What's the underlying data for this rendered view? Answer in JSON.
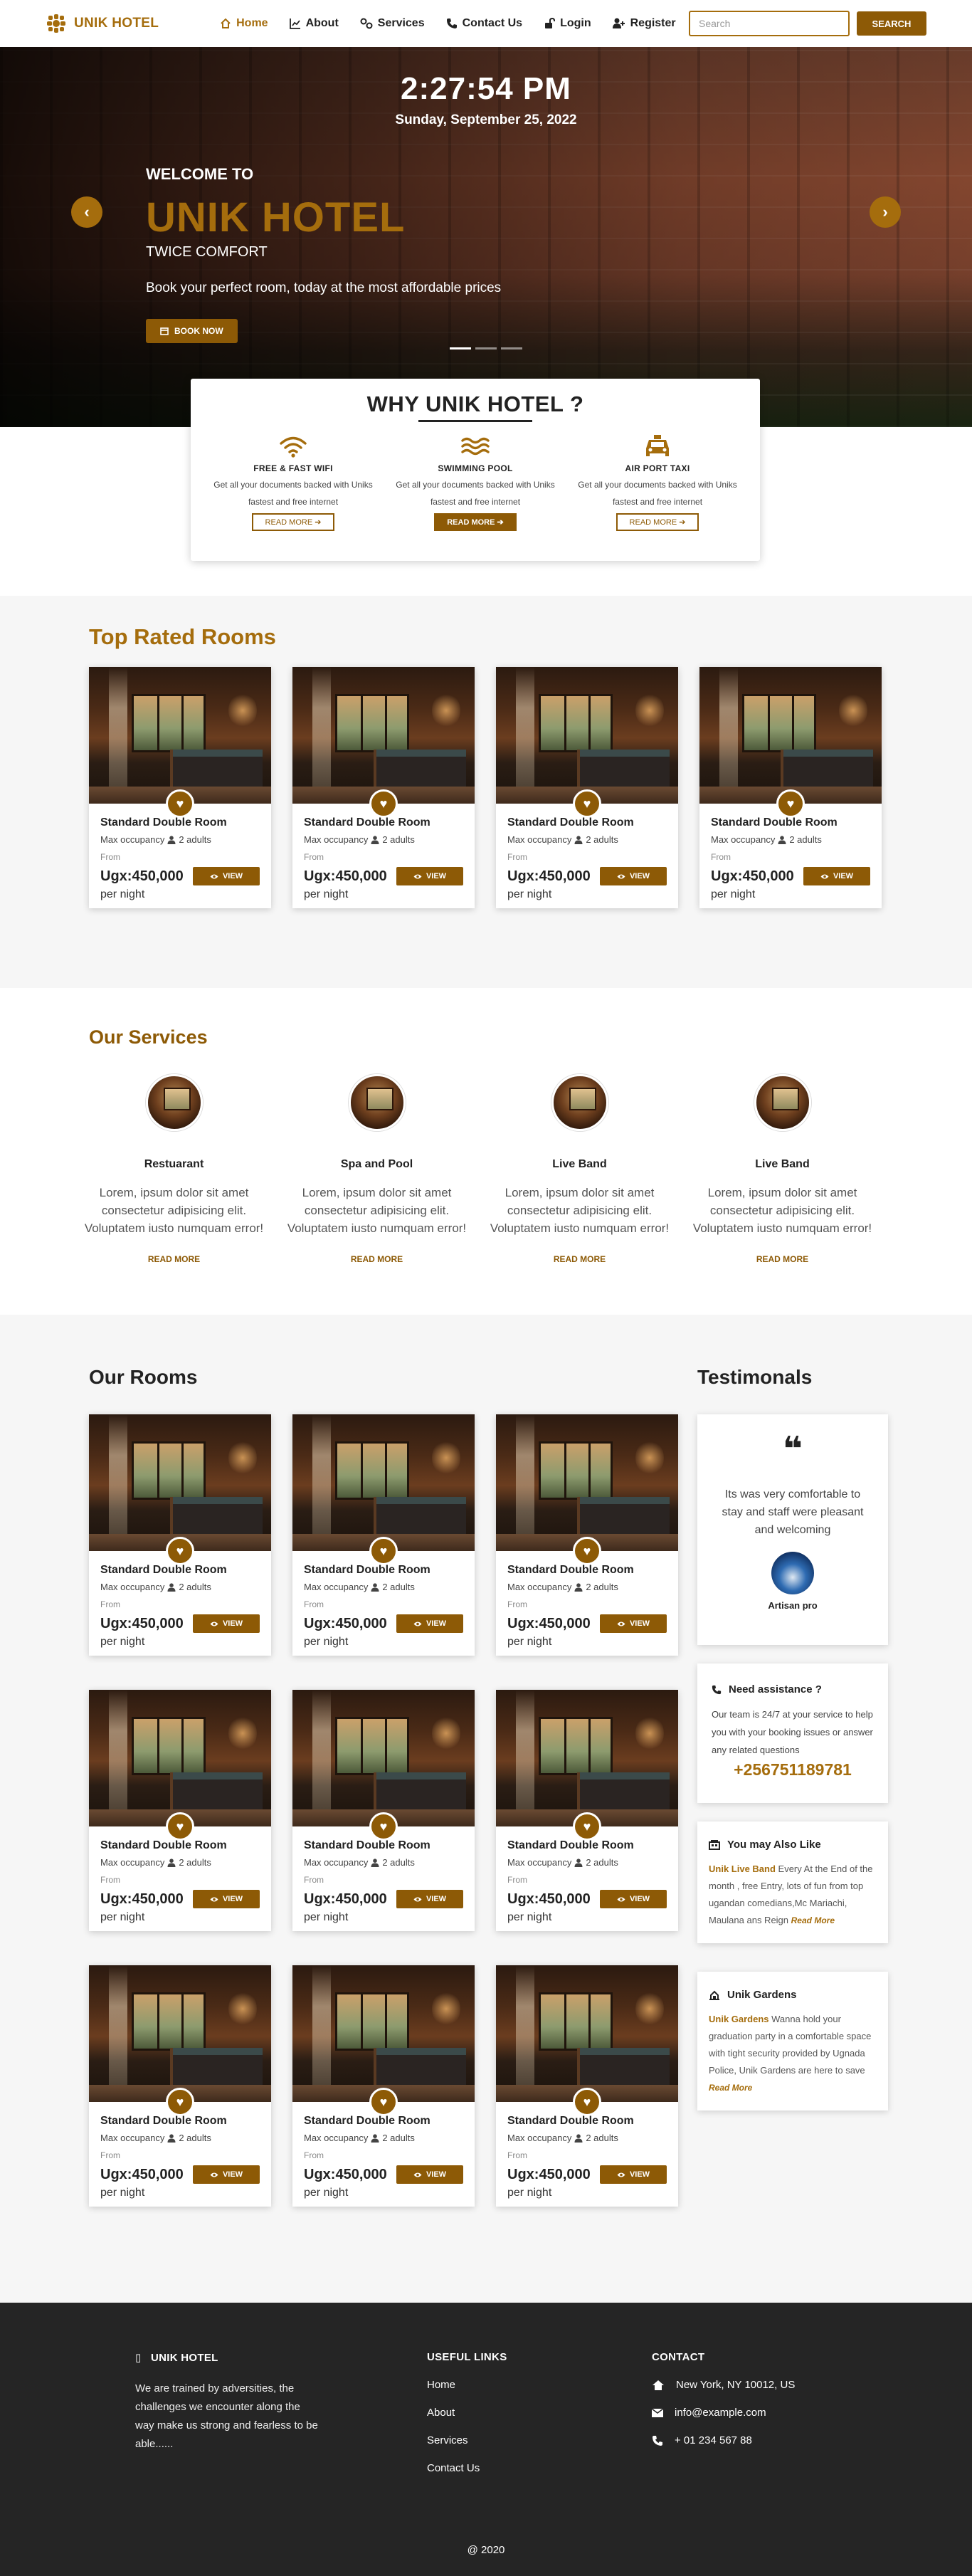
{
  "nav": {
    "brand": "UNIK HOTEL",
    "items": [
      {
        "label": "Home",
        "icon": "home-icon",
        "active": true
      },
      {
        "label": "About",
        "icon": "chart-icon"
      },
      {
        "label": "Services",
        "icon": "services-icon"
      },
      {
        "label": "Contact Us",
        "icon": "phone-icon"
      },
      {
        "label": "Login",
        "icon": "login-icon"
      },
      {
        "label": "Register",
        "icon": "register-icon"
      }
    ],
    "search_placeholder": "Search",
    "search_button": "SEARCH"
  },
  "hero": {
    "time": "2:27:54 PM",
    "date": "Sunday, September 25, 2022",
    "welcome": "WELCOME TO",
    "title": "UNIK HOTEL",
    "tagline": "TWICE COMFORT",
    "subline": "Book your perfect room, today at the most affordable prices",
    "book_button": "BOOK NOW",
    "prev": "‹",
    "next": "›"
  },
  "why": {
    "title": "WHY UNIK HOTEL ?",
    "features": [
      {
        "title": "FREE & FAST WIFI",
        "icon": "wifi-icon",
        "desc": "Get all your documents backed with Uniks fastest and free internet",
        "button": "READ MORE"
      },
      {
        "title": "SWIMMING POOL",
        "icon": "pool-icon",
        "desc": "Get all your documents backed with Uniks fastest and free internet",
        "button": "READ MORE"
      },
      {
        "title": "AIR PORT TAXI",
        "icon": "taxi-icon",
        "desc": "Get all your documents backed with Uniks fastest and free internet",
        "button": "READ MORE"
      }
    ]
  },
  "room_card": {
    "name": "Standard Double Room",
    "occupancy": "Max occupancy",
    "adults": "2 adults",
    "from": "From",
    "price": "Ugx:450,000",
    "view": "VIEW",
    "per_night": "per night"
  },
  "top_rated": {
    "title": "Top Rated Rooms"
  },
  "services": {
    "title": "Our Services",
    "items": [
      {
        "name": "Restuarant",
        "desc": "Lorem, ipsum dolor sit amet consectetur adipisicing elit. Voluptatem iusto numquam error!",
        "link": "READ MORE"
      },
      {
        "name": "Spa and Pool",
        "desc": "Lorem, ipsum dolor sit amet consectetur adipisicing elit. Voluptatem iusto numquam error!",
        "link": "READ MORE"
      },
      {
        "name": "Live Band",
        "desc": "Lorem, ipsum dolor sit amet consectetur adipisicing elit. Voluptatem iusto numquam error!",
        "link": "READ MORE"
      },
      {
        "name": "Live Band",
        "desc": "Lorem, ipsum dolor sit amet consectetur adipisicing elit. Voluptatem iusto numquam error!",
        "link": "READ MORE"
      }
    ]
  },
  "our_rooms": {
    "title": "Our Rooms"
  },
  "testimonials": {
    "title": "Testimonals",
    "quote_mark": "❝",
    "text": "Its was very comfortable to stay and staff were pleasant and welcoming",
    "author": "Artisan pro"
  },
  "assistance": {
    "title": "Need assistance ?",
    "text": "Our team is 24/7 at your service to help you with your booking issues or answer any related questions",
    "phone": "+256751189781"
  },
  "also_like": {
    "title": "You may Also Like",
    "highlight": "Unik Live Band",
    "text": " Every At the End of the month , free Entry, lots of fun from top ugandan comedians,Mc Mariachi, Maulana ans Reign ",
    "more": "Read More"
  },
  "gardens": {
    "title": "Unik Gardens",
    "highlight": "Unik Gardens",
    "text": " Wanna hold your graduation party in a comfortable space with tight security provided by Ugnada Police, Unik Gardens are here to save ",
    "more": "Read More"
  },
  "footer": {
    "about_title": "UNIK HOTEL",
    "about_text": "We are trained by adversities, the challenges we encounter along the way make us strong and fearless to be able......",
    "links_title": "USEFUL LINKS",
    "links": [
      "Home",
      "About",
      "Services",
      "Contact Us"
    ],
    "contact_title": "CONTACT",
    "address": "New York, NY 10012, US",
    "email": "info@example.com",
    "phone": "+ 01 234 567 88",
    "copyright": "@ 2020"
  },
  "colors": {
    "accent": "#a56d0d",
    "button": "#8d5a06",
    "footer": "#252525"
  }
}
